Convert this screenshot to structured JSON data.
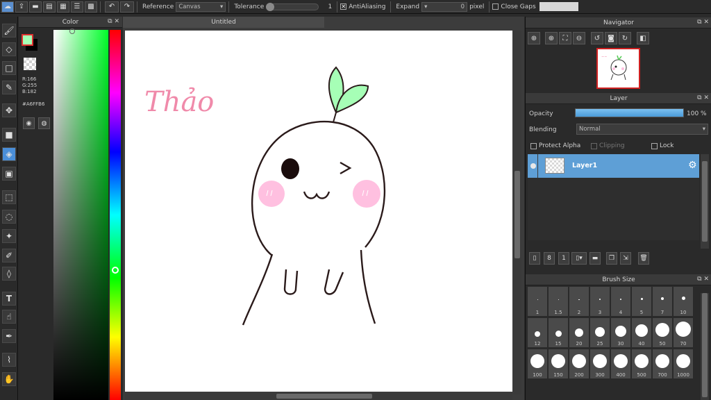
{
  "toolbar": {
    "reference_label": "Reference",
    "reference_value": "Canvas",
    "tolerance_label": "Tolerance",
    "tolerance_value": "1",
    "antialiasing_label": "AntiAliasing",
    "antialiasing_checked": true,
    "expand_label": "Expand",
    "expand_value": "0",
    "pixel_label": "pixel",
    "close_gaps_label": "Close Gaps",
    "close_gaps_checked": false
  },
  "color_panel": {
    "title": "Color",
    "r": "R:166",
    "g": "G:255",
    "b": "B:182",
    "hex": "#A6FFB6",
    "current_color": "#A6FFB6",
    "background_color": "#000000"
  },
  "canvas": {
    "title": "Untitled",
    "signature": "Thảo"
  },
  "navigator": {
    "title": "Navigator"
  },
  "layer_panel": {
    "title": "Layer",
    "opacity_label": "Opacity",
    "opacity_value": "100 %",
    "opacity_fraction": 1.0,
    "blending_label": "Blending",
    "blending_value": "Normal",
    "protect_alpha_label": "Protect Alpha",
    "clipping_label": "Clipping",
    "lock_label": "Lock",
    "layers": [
      {
        "name": "Layer1",
        "selected": true
      }
    ]
  },
  "brush_panel": {
    "title": "Brush Size",
    "sizes": [
      "1",
      "1.5",
      "2",
      "3",
      "4",
      "5",
      "7",
      "10",
      "12",
      "15",
      "20",
      "25",
      "30",
      "40",
      "50",
      "70",
      "100",
      "150",
      "200",
      "300",
      "400",
      "500",
      "700",
      "1000"
    ]
  },
  "colors": {
    "accent": "#4a8ed8",
    "selected_layer": "#5e9fd6",
    "signature": "#f08aaa"
  },
  "icons": {
    "tools": [
      "brush-icon",
      "eraser-icon",
      "rectangle-icon",
      "pen-icon",
      "move-icon",
      "square-fill-icon",
      "bucket-icon",
      "gradient-icon",
      "select-rect-icon",
      "select-lasso-icon",
      "magic-wand-icon",
      "select-pen-icon",
      "text-icon",
      "select-finger-icon",
      "eyedropper-pen-icon",
      "eyedropper-icon",
      "hand-icon"
    ]
  }
}
